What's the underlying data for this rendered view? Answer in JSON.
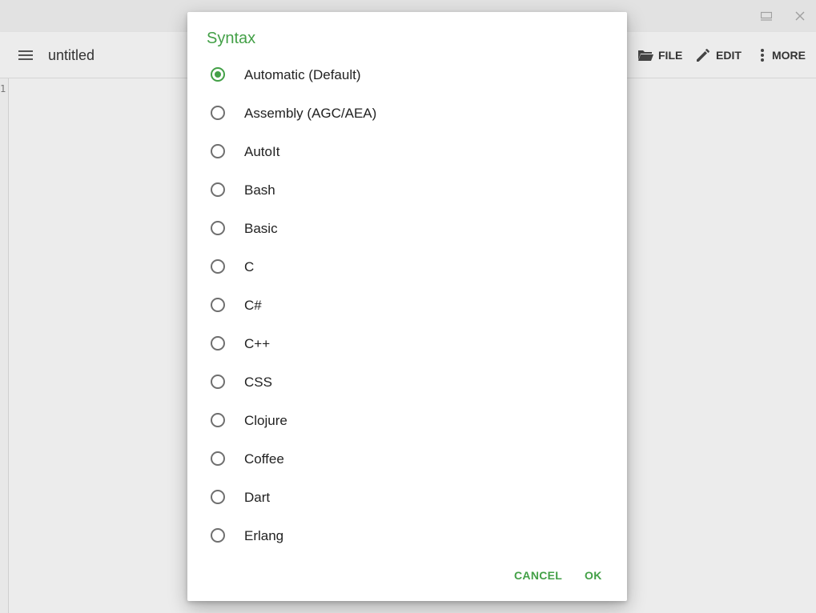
{
  "window": {
    "minimize_icon": "minimize-icon",
    "close_icon": "close-icon"
  },
  "toolbar": {
    "menu_icon": "hamburger-icon",
    "title": "untitled",
    "file_label": "FILE",
    "edit_label": "EDIT",
    "more_label": "MORE"
  },
  "editor": {
    "line_number": "1"
  },
  "dialog": {
    "title": "Syntax",
    "options": [
      {
        "label": "Automatic (Default)",
        "selected": true
      },
      {
        "label": "Assembly (AGC/AEA)",
        "selected": false
      },
      {
        "label": "AutoIt",
        "selected": false
      },
      {
        "label": "Bash",
        "selected": false
      },
      {
        "label": "Basic",
        "selected": false
      },
      {
        "label": "C",
        "selected": false
      },
      {
        "label": "C#",
        "selected": false
      },
      {
        "label": "C++",
        "selected": false
      },
      {
        "label": "CSS",
        "selected": false
      },
      {
        "label": "Clojure",
        "selected": false
      },
      {
        "label": "Coffee",
        "selected": false
      },
      {
        "label": "Dart",
        "selected": false
      },
      {
        "label": "Erlang",
        "selected": false
      }
    ],
    "cancel_label": "CANCEL",
    "ok_label": "OK",
    "accent_color": "#43a047"
  }
}
